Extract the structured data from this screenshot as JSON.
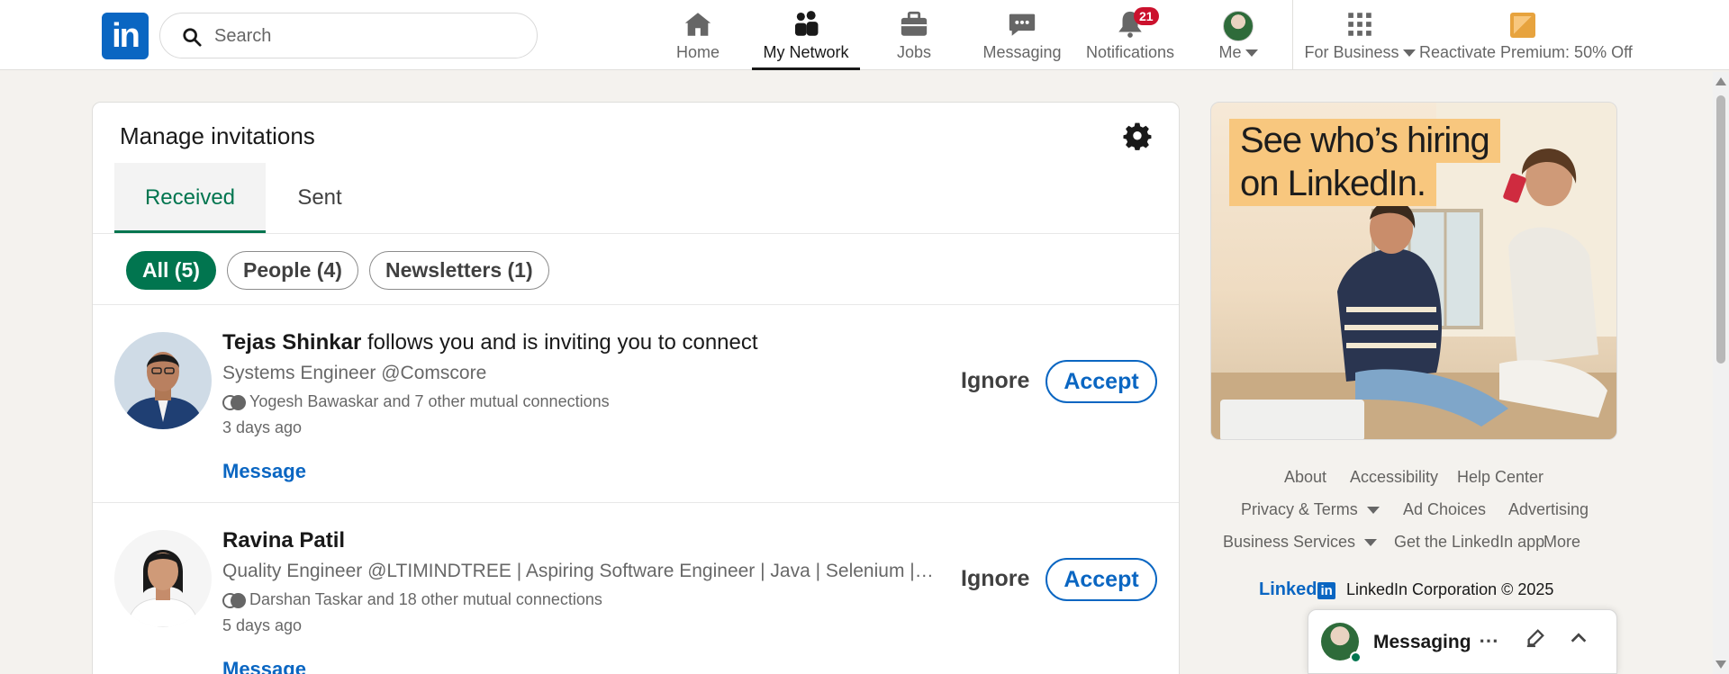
{
  "nav": {
    "logo_text": "in",
    "search_placeholder": "Search",
    "items": [
      {
        "label": "Home",
        "icon": "home-icon"
      },
      {
        "label": "My Network",
        "icon": "people-icon"
      },
      {
        "label": "Jobs",
        "icon": "briefcase-icon"
      },
      {
        "label": "Messaging",
        "icon": "chat-icon"
      },
      {
        "label": "Notifications",
        "icon": "bell-icon",
        "badge": "21"
      },
      {
        "label": "Me",
        "icon": "avatar"
      }
    ],
    "active": "My Network",
    "for_business": "For Business",
    "premium": "Reactivate Premium: 50% Off"
  },
  "main": {
    "title": "Manage invitations",
    "tabs": [
      {
        "label": "Received",
        "active": true
      },
      {
        "label": "Sent",
        "active": false
      }
    ],
    "filters": [
      {
        "label": "All (5)",
        "active": true
      },
      {
        "label": "People (4)",
        "active": false
      },
      {
        "label": "Newsletters (1)",
        "active": false
      }
    ],
    "invitations": [
      {
        "name": "Tejas Shinkar",
        "action": " follows you and is inviting you to connect",
        "headline": "Systems Engineer @Comscore",
        "mutual": "Yogesh Bawaskar and 7 other mutual connections",
        "time": "3 days ago",
        "message_label": "Message",
        "ignore_label": "Ignore",
        "accept_label": "Accept"
      },
      {
        "name": "Ravina Patil",
        "action": "",
        "headline": "Quality Engineer @LTIMINDTREE | Aspiring Software Engineer | Java | Selenium | BD...",
        "mutual": "Darshan Taskar and 18 other mutual connections",
        "time": "5 days ago",
        "message_label": "Message",
        "ignore_label": "Ignore",
        "accept_label": "Accept"
      }
    ]
  },
  "ad": {
    "line1": "See who’s hiring",
    "line2": "on LinkedIn."
  },
  "footer": {
    "links": [
      "About",
      "Accessibility",
      "Help Center",
      "Privacy & Terms",
      "Ad Choices",
      "Advertising",
      "Business Services",
      "Get the LinkedIn app",
      "More"
    ],
    "brand": "Linked",
    "brand_in": "in",
    "copyright": "LinkedIn Corporation © 2025"
  },
  "messaging_dock": {
    "title": "Messaging",
    "more": "⋯"
  },
  "colors": {
    "brand": "#0a66c2",
    "green": "#01754f",
    "badge": "#cb112d",
    "ad_highlight": "#f8c77e"
  }
}
